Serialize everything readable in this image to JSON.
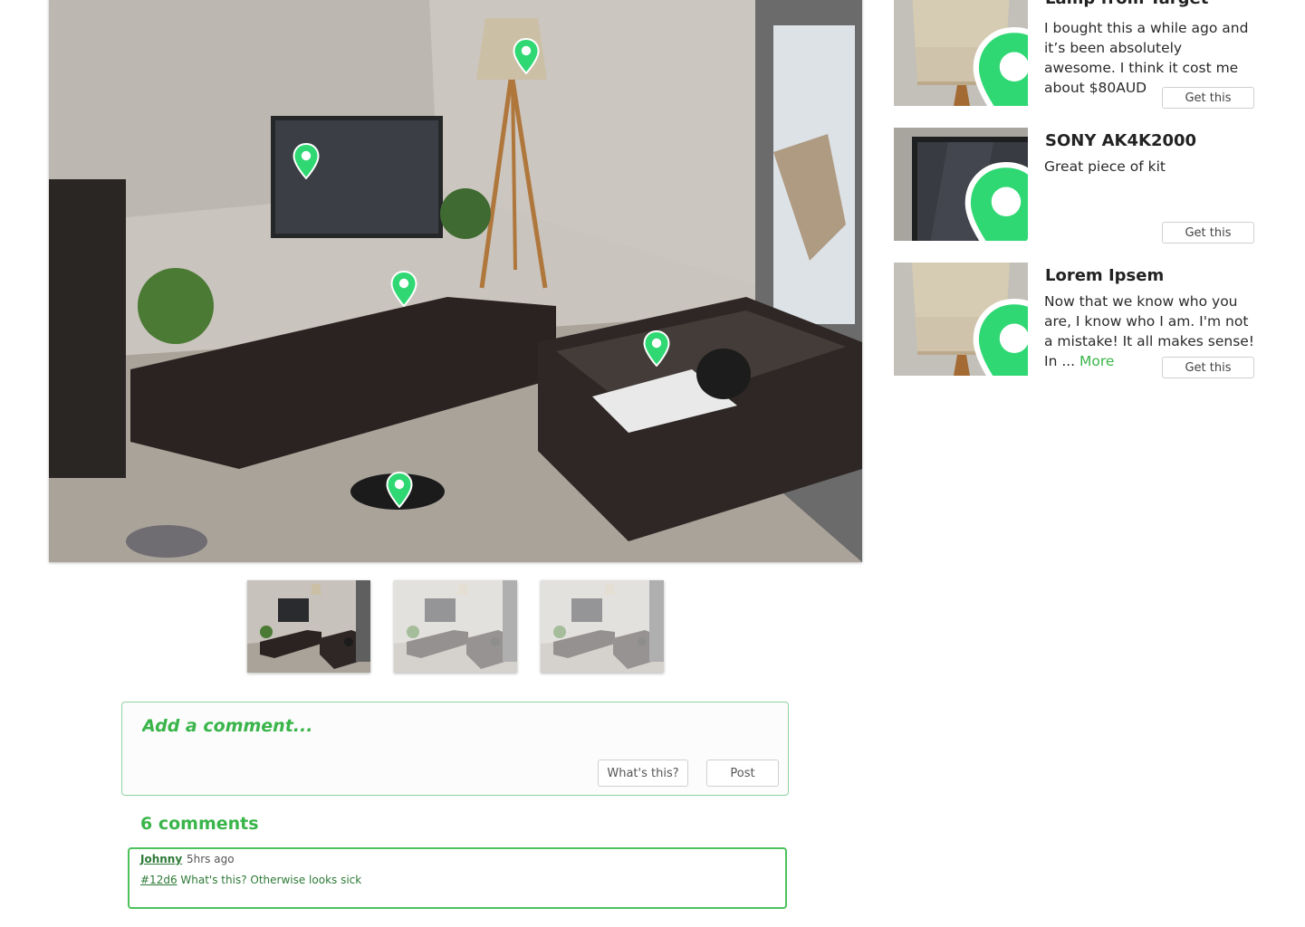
{
  "photo": {
    "pins": [
      {
        "name": "pin-lamp"
      },
      {
        "name": "pin-tv"
      },
      {
        "name": "pin-speaker"
      },
      {
        "name": "pin-table"
      },
      {
        "name": "pin-shoes"
      }
    ],
    "thumbnails": [
      {
        "name": "thumbnail-1",
        "active": true
      },
      {
        "name": "thumbnail-2",
        "active": false
      },
      {
        "name": "thumbnail-3",
        "active": false
      }
    ]
  },
  "comment_form": {
    "placeholder": "Add a comment...",
    "whats_this_label": "What's this?",
    "post_label": "Post"
  },
  "comments": {
    "count_label": "6 comments",
    "items": [
      {
        "author": "Johnny",
        "time": "5hrs ago",
        "ref": "#12d6",
        "text": "What's this? Otherwise looks sick"
      }
    ]
  },
  "items": [
    {
      "title": "Lamp from Target",
      "description": "I bought this a while ago and it’s been absolutely awesome. I think it cost me about $80AUD",
      "more_label": "",
      "button_label": "Get this",
      "image": "lamp-shade"
    },
    {
      "title": "SONY AK4K2000",
      "description": "Great piece of kit",
      "more_label": "",
      "button_label": "Get this",
      "image": "tv-screen"
    },
    {
      "title": "Lorem Ipsem",
      "description": "Now that we know who you are, I know who I am. I'm not a mistake! It all makes sense! In ...",
      "more_label": "More",
      "button_label": "Get this",
      "image": "lamp-shade"
    }
  ],
  "colors": {
    "accent": "#3ab54a",
    "pin": "#3ee07a",
    "comment_border": "#4cc25b"
  },
  "icons": {
    "pin": "map-pin-icon"
  }
}
